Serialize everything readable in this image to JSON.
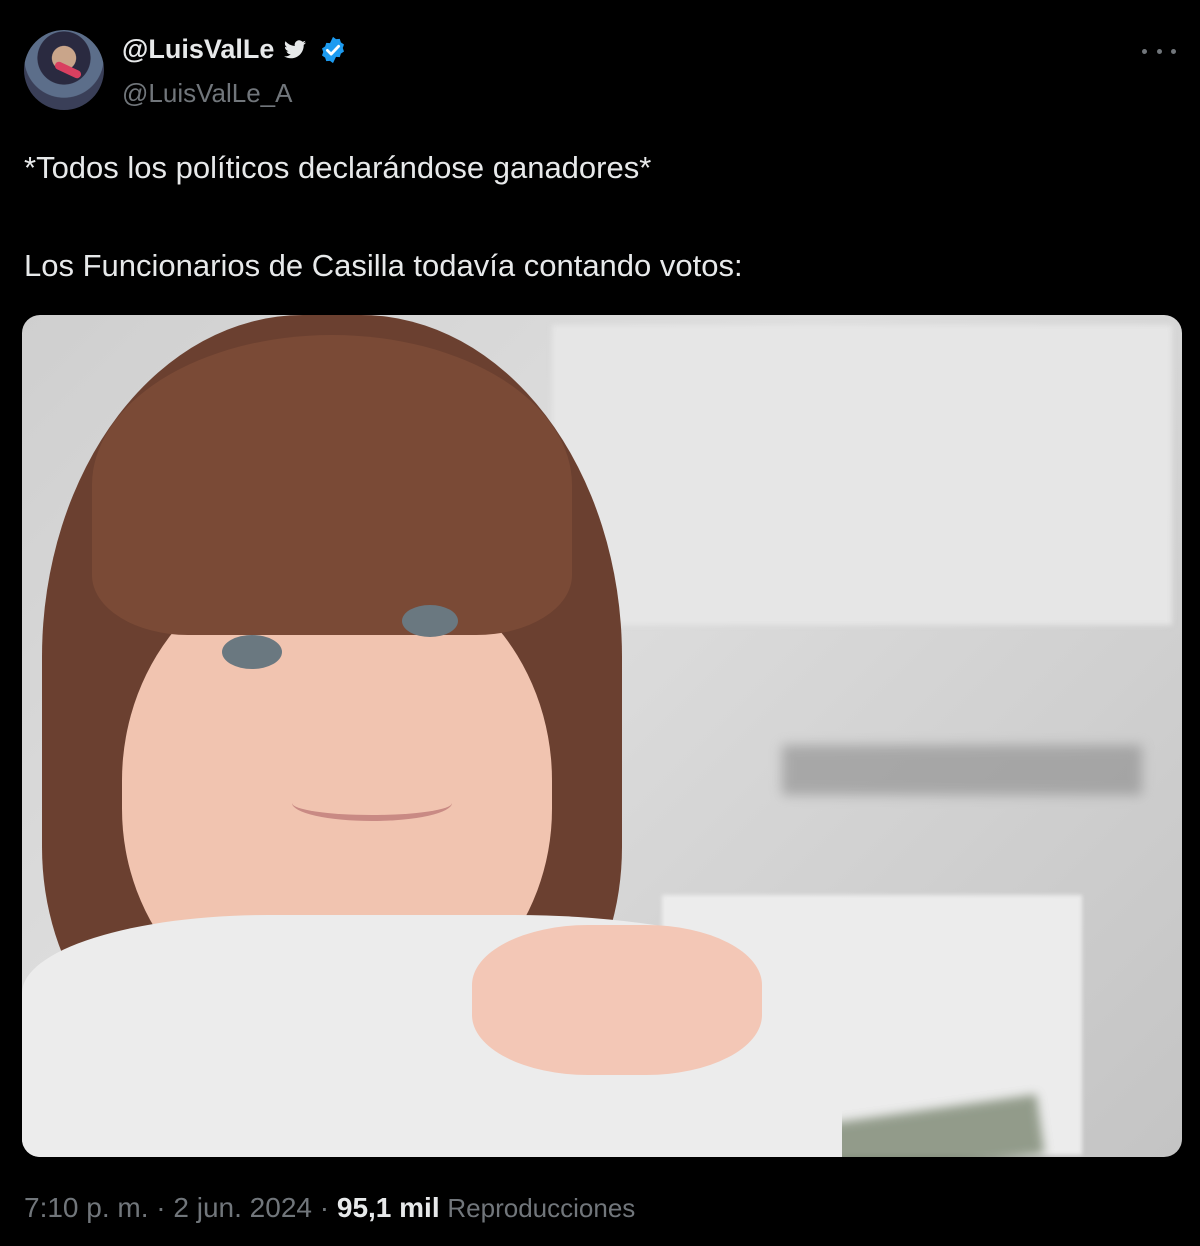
{
  "author": {
    "display_name": "@LuisValLe",
    "handle": "@LuisValLe_A",
    "verified": true,
    "bird_icon": "twitter-bird-icon",
    "verified_icon": "verified-badge-icon"
  },
  "menu_icon": "more-options-icon",
  "tweet": {
    "line1": "*Todos los políticos declarándose ganadores*",
    "line2": "Los Funcionarios de Casilla todavía contando votos:"
  },
  "media": {
    "type": "photo"
  },
  "footer": {
    "time": "7:10 p. m.",
    "separator": "·",
    "date": "2 jun. 2024",
    "views_count": "95,1 mil",
    "views_label": "Reproducciones"
  },
  "colors": {
    "background": "#000000",
    "primary_text": "#e7e9ea",
    "secondary_text": "#71767b",
    "verified_blue": "#1d9bf0"
  }
}
